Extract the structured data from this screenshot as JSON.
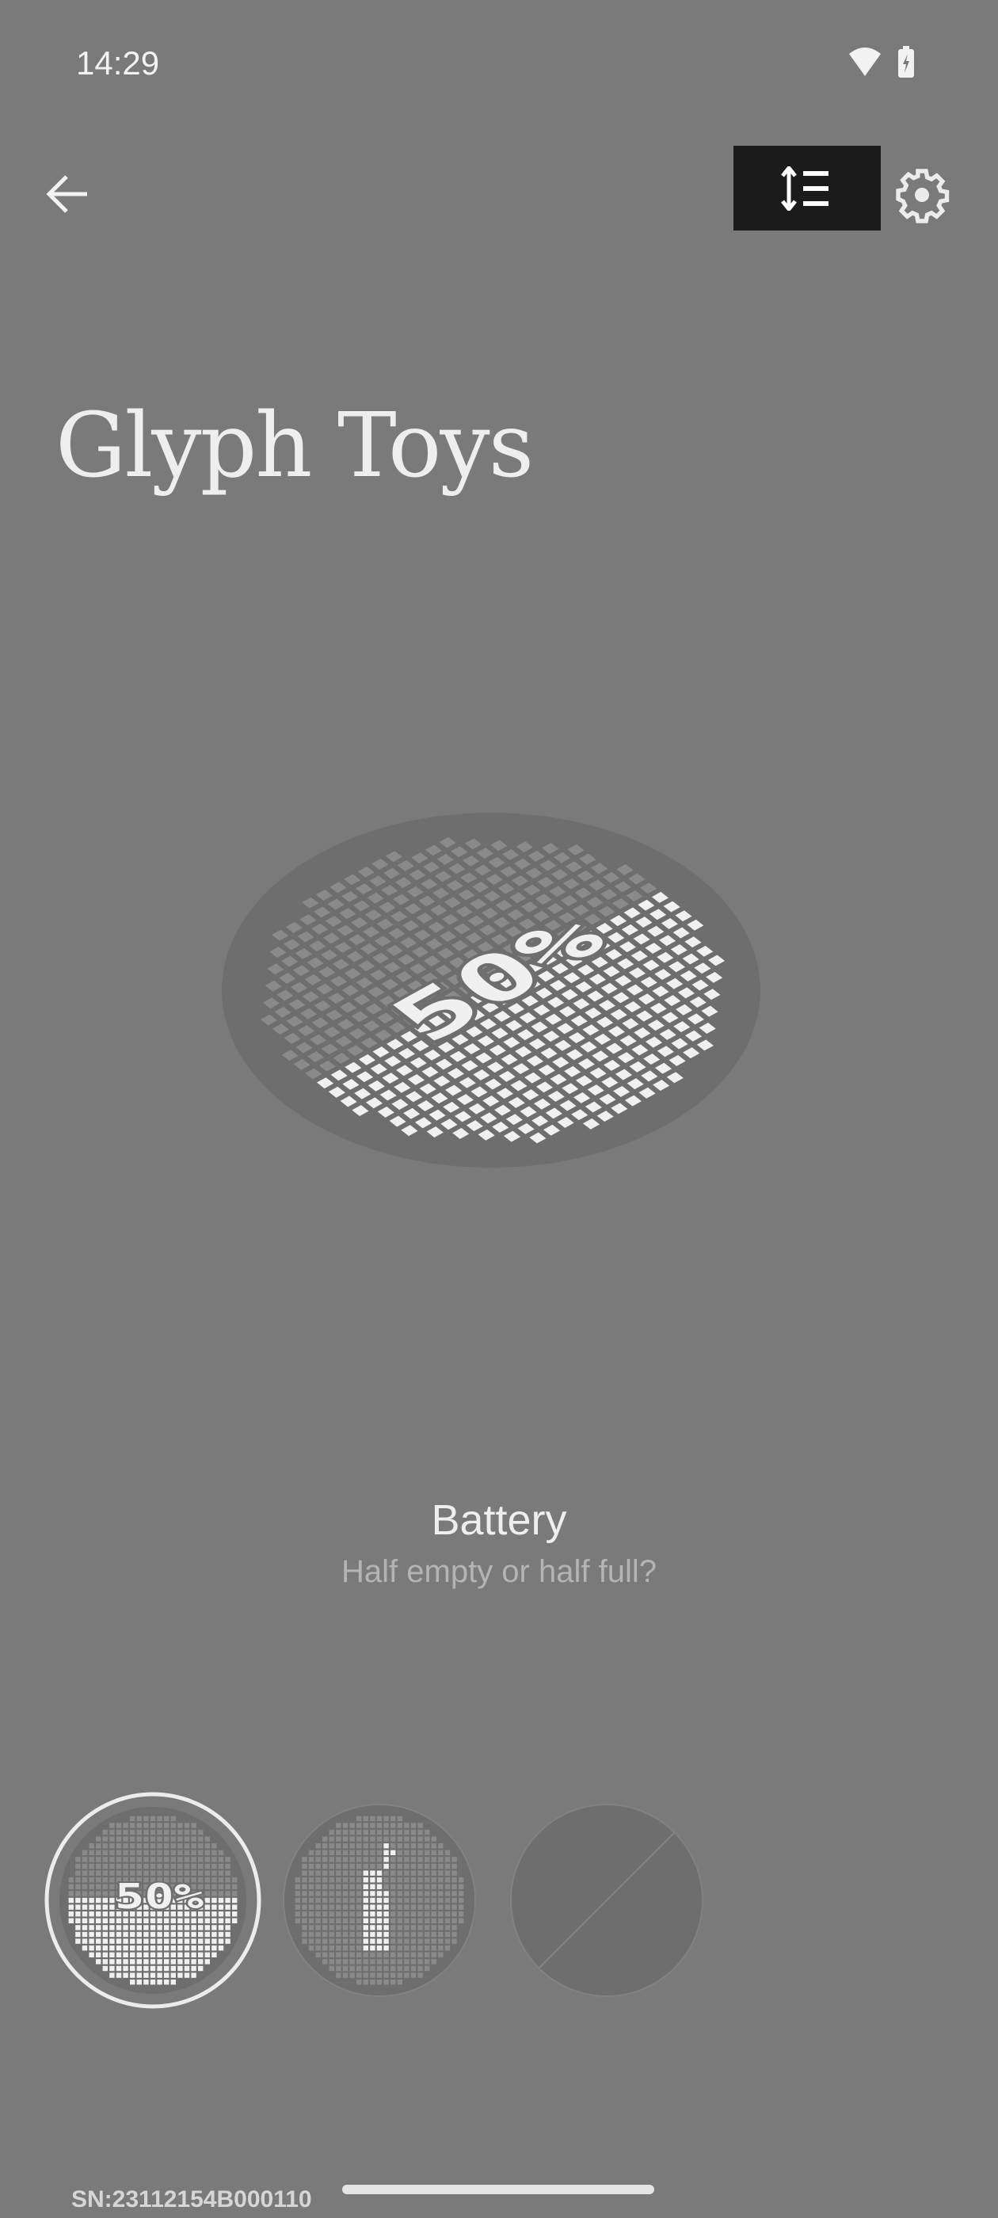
{
  "status_bar": {
    "time": "14:29",
    "icons": [
      "wifi-icon",
      "battery-charging-icon"
    ]
  },
  "toolbar": {
    "back_icon": "arrow-left-icon",
    "sort_icon": "reorder-list-icon",
    "settings_icon": "gear-icon"
  },
  "page": {
    "title": "Glyph Toys"
  },
  "selected_toy": {
    "name": "Battery",
    "description": "Half empty or half full?",
    "preview_text": "50%",
    "battery_level": 0.5
  },
  "toys": [
    {
      "name": "battery",
      "selected": true
    },
    {
      "name": "sand-timer",
      "selected": false
    },
    {
      "name": "none",
      "selected": false
    }
  ],
  "footer": {
    "serial": "SN:23112154B000110"
  },
  "colors": {
    "background": "#7a7a7a",
    "lit": "#f0f0f0",
    "dim": "#8a8a8a",
    "plate": "#6e6e6e",
    "button": "#1b1b1b"
  }
}
